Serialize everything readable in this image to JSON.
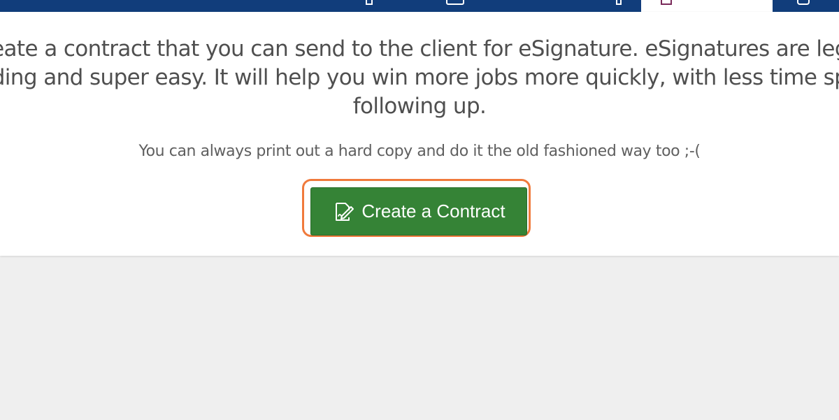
{
  "intro": {
    "lines": [
      "eate a contract that you can send to the client for eSignature. eSignatures are leg",
      "ding and super easy. It will help you win more jobs more quickly, with less time sp",
      "following up."
    ]
  },
  "note": "You can always print out a hard copy and do it the old fashioned way too ;-(",
  "create_button": {
    "label": "Create a Contract",
    "icon": "edit-document-icon"
  },
  "colors": {
    "topbar": "#113d7b",
    "button": "#358336",
    "highlight": "#f07a3c"
  }
}
